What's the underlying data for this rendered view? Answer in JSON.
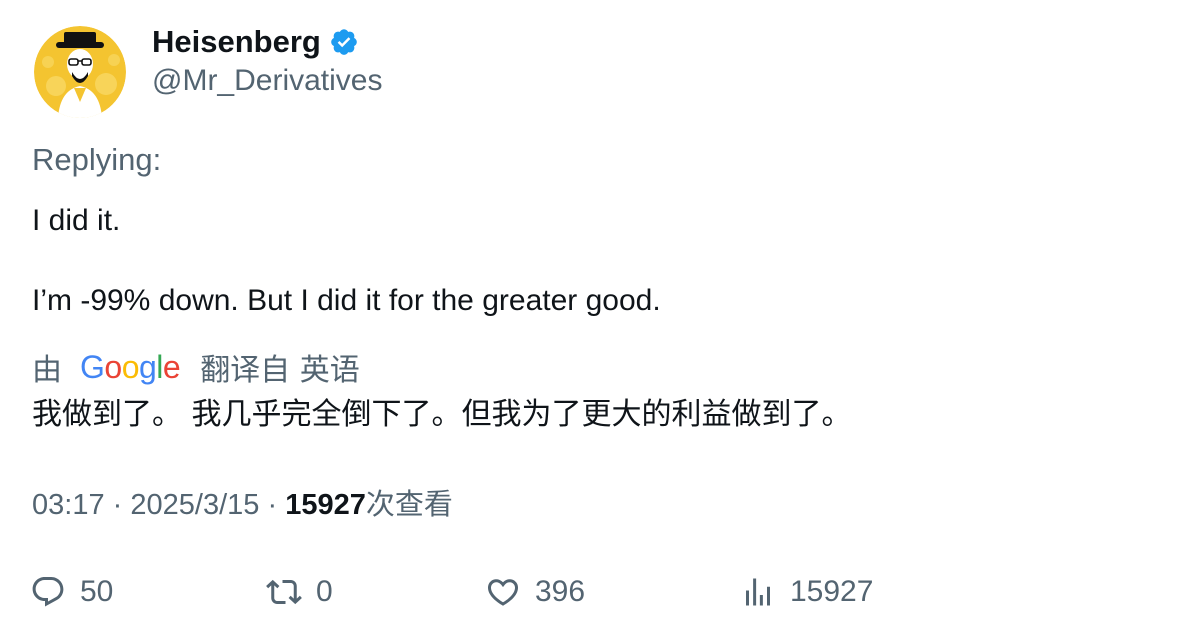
{
  "author": {
    "display_name": "Heisenberg",
    "handle": "@Mr_Derivatives",
    "verified": true,
    "avatar_icon": "heisenberg-avatar"
  },
  "reply_context": {
    "label": "Replying:"
  },
  "tweet": {
    "lines": [
      "I did it.",
      "I’m -99% down. But I did it for the greater good."
    ]
  },
  "translation": {
    "by_label": "由",
    "provider": "Google",
    "from_label": "翻译自 英语",
    "text": "我做到了。 我几乎完全倒下了。但我为了更大的利益做到了。"
  },
  "meta": {
    "time": "03:17",
    "separator": "·",
    "date": "2025/3/15",
    "views_count": "15927",
    "views_label": "次查看"
  },
  "actions": {
    "replies": "50",
    "retweets": "0",
    "likes": "396",
    "views": "15927"
  },
  "colors": {
    "text_primary": "#0f1419",
    "text_secondary": "#536471",
    "verified_blue": "#1d9bf0",
    "avatar_bg": "#f4c430"
  }
}
